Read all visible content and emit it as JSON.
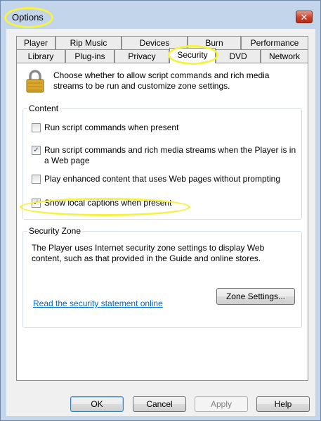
{
  "window": {
    "title": "Options",
    "close_label": "✕"
  },
  "tabs": {
    "row1": [
      "Player",
      "Rip Music",
      "Devices",
      "Burn",
      "Performance"
    ],
    "row2": [
      "Library",
      "Plug-ins",
      "Privacy",
      "Security",
      "DVD",
      "Network"
    ],
    "active": "Security"
  },
  "security": {
    "description": "Choose whether to allow script commands and rich media streams to be run and customize zone settings.",
    "content_group": {
      "legend": "Content",
      "options": [
        {
          "label": "Run script commands when present",
          "checked": false
        },
        {
          "label": "Run script commands and rich media streams when the Player is in a Web page",
          "checked": true
        },
        {
          "label": "Play enhanced content that uses Web pages without prompting",
          "checked": false
        },
        {
          "label": "Show local captions when present",
          "checked": true
        }
      ]
    },
    "zone_group": {
      "legend": "Security Zone",
      "text": "The Player uses Internet security zone settings to display Web content, such as that provided in the Guide and online stores.",
      "link": "Read the security statement online",
      "zone_button": "Zone Settings..."
    }
  },
  "buttons": {
    "ok": "OK",
    "cancel": "Cancel",
    "apply": "Apply",
    "help": "Help"
  },
  "colors": {
    "highlight": "#f5f243",
    "link": "#0066cc",
    "close": "#c9412a"
  },
  "icons": {
    "lock": "lock-icon",
    "check": "checkmark-icon",
    "close": "close-icon"
  }
}
